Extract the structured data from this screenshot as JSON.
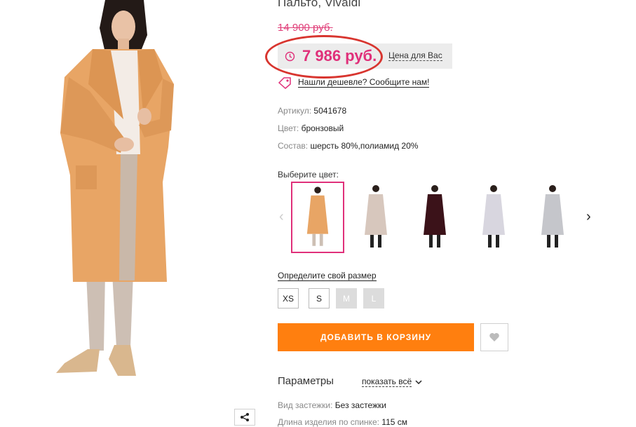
{
  "product": {
    "title": "Пальто, Vivaldi",
    "old_price": "14 900 руб.",
    "price": "7 986 руб.",
    "price_for_you": "Цена для Вас",
    "cheaper_link": "Нашли дешевле? Сообщите нам!"
  },
  "attributes": [
    {
      "key": "Артикул:",
      "value": "5041678"
    },
    {
      "key": "Цвет:",
      "value": "бронзовый"
    },
    {
      "key": "Состав:",
      "value": "шерсть 80%,полиамид 20%"
    }
  ],
  "color_picker": {
    "label": "Выберите цвет:",
    "swatches": [
      {
        "color": "#e8a565",
        "selected": true
      },
      {
        "color": "#d7c7bd",
        "selected": false
      },
      {
        "color": "#3b1219",
        "selected": false
      },
      {
        "color": "#d8d6df",
        "selected": false
      },
      {
        "color": "#c5c6cb",
        "selected": false
      }
    ]
  },
  "sizes": {
    "label": "Определите свой размер",
    "options": [
      {
        "label": "XS",
        "available": true
      },
      {
        "label": "S",
        "available": true
      },
      {
        "label": "M",
        "available": false
      },
      {
        "label": "L",
        "available": false
      }
    ]
  },
  "actions": {
    "add_to_cart": "ДОБАВИТЬ В КОРЗИНУ"
  },
  "params": {
    "title": "Параметры",
    "show_all": "показать всё",
    "items": [
      {
        "key": "Вид застежки:",
        "value": "Без застежки"
      },
      {
        "key": "Длина изделия по спинке:",
        "value": "115 см"
      }
    ]
  },
  "colors": {
    "accent_pink": "#e0307a",
    "cart_orange": "#ff7f0f",
    "highlight_red": "#d8352f",
    "main_coat": "#e8a565"
  },
  "icons": {
    "clock": "clock-icon",
    "tag": "tag-icon",
    "heart": "heart-icon",
    "share": "share-icon",
    "chevron_left": "chevron-left-icon",
    "chevron_right": "chevron-right-icon",
    "chevron_down": "chevron-down-icon"
  }
}
